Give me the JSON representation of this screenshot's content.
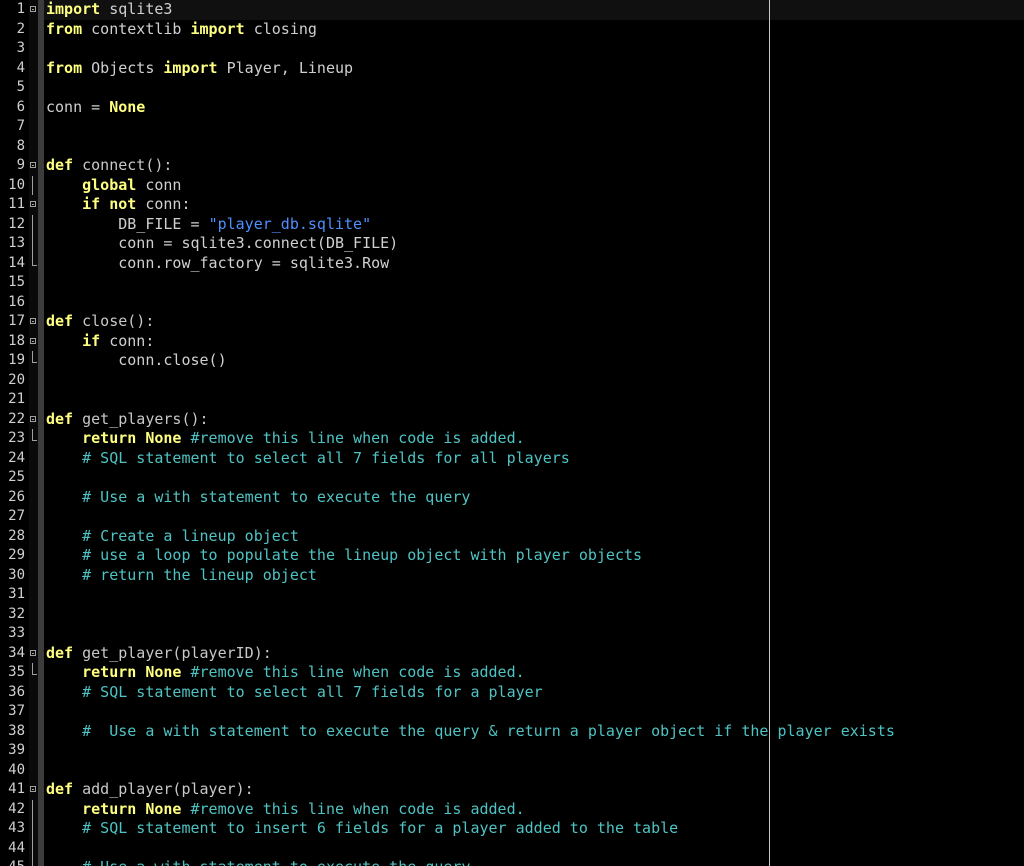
{
  "editor": {
    "lines": [
      {
        "n": "1",
        "fold": "box",
        "tokens": [
          {
            "t": "kw",
            "v": "import"
          },
          {
            "t": "txt",
            "v": " sqlite3"
          }
        ]
      },
      {
        "n": "2",
        "fold": "",
        "tokens": [
          {
            "t": "kw",
            "v": "from"
          },
          {
            "t": "txt",
            "v": " contextlib "
          },
          {
            "t": "kw",
            "v": "import"
          },
          {
            "t": "txt",
            "v": " closing"
          }
        ]
      },
      {
        "n": "3",
        "fold": "",
        "tokens": []
      },
      {
        "n": "4",
        "fold": "",
        "tokens": [
          {
            "t": "kw",
            "v": "from"
          },
          {
            "t": "txt",
            "v": " Objects "
          },
          {
            "t": "kw",
            "v": "import"
          },
          {
            "t": "txt",
            "v": " Player, Lineup"
          }
        ]
      },
      {
        "n": "5",
        "fold": "",
        "tokens": []
      },
      {
        "n": "6",
        "fold": "",
        "tokens": [
          {
            "t": "txt",
            "v": "conn = "
          },
          {
            "t": "kw",
            "v": "None"
          }
        ]
      },
      {
        "n": "7",
        "fold": "",
        "tokens": []
      },
      {
        "n": "8",
        "fold": "",
        "tokens": []
      },
      {
        "n": "9",
        "fold": "box",
        "tokens": [
          {
            "t": "kw",
            "v": "def"
          },
          {
            "t": "fn",
            "v": " connect():"
          }
        ]
      },
      {
        "n": "10",
        "fold": "line",
        "tokens": [
          {
            "t": "txt",
            "v": "    "
          },
          {
            "t": "kw",
            "v": "global"
          },
          {
            "t": "txt",
            "v": " conn"
          }
        ]
      },
      {
        "n": "11",
        "fold": "box",
        "tokens": [
          {
            "t": "txt",
            "v": "    "
          },
          {
            "t": "kw",
            "v": "if not"
          },
          {
            "t": "txt",
            "v": " conn:"
          }
        ]
      },
      {
        "n": "12",
        "fold": "line",
        "tokens": [
          {
            "t": "txt",
            "v": "        DB_FILE = "
          },
          {
            "t": "str",
            "v": "\"player_db.sqlite\""
          }
        ]
      },
      {
        "n": "13",
        "fold": "line",
        "tokens": [
          {
            "t": "txt",
            "v": "        conn = sqlite3.connect(DB_FILE)"
          }
        ]
      },
      {
        "n": "14",
        "fold": "end",
        "tokens": [
          {
            "t": "txt",
            "v": "        conn.row_factory = sqlite3.Row"
          }
        ]
      },
      {
        "n": "15",
        "fold": "",
        "tokens": []
      },
      {
        "n": "16",
        "fold": "",
        "tokens": []
      },
      {
        "n": "17",
        "fold": "box",
        "tokens": [
          {
            "t": "kw",
            "v": "def"
          },
          {
            "t": "fn",
            "v": " close():"
          }
        ]
      },
      {
        "n": "18",
        "fold": "box",
        "tokens": [
          {
            "t": "txt",
            "v": "    "
          },
          {
            "t": "kw",
            "v": "if"
          },
          {
            "t": "txt",
            "v": " conn:"
          }
        ]
      },
      {
        "n": "19",
        "fold": "end",
        "tokens": [
          {
            "t": "txt",
            "v": "        conn.close()"
          }
        ]
      },
      {
        "n": "20",
        "fold": "",
        "tokens": []
      },
      {
        "n": "21",
        "fold": "",
        "tokens": []
      },
      {
        "n": "22",
        "fold": "box",
        "tokens": [
          {
            "t": "kw",
            "v": "def"
          },
          {
            "t": "fn",
            "v": " get_players():"
          }
        ]
      },
      {
        "n": "23",
        "fold": "end",
        "tokens": [
          {
            "t": "txt",
            "v": "    "
          },
          {
            "t": "kw",
            "v": "return None"
          },
          {
            "t": "txt",
            "v": " "
          },
          {
            "t": "com",
            "v": "#remove this line when code is added."
          }
        ]
      },
      {
        "n": "24",
        "fold": "",
        "tokens": [
          {
            "t": "txt",
            "v": "    "
          },
          {
            "t": "com",
            "v": "# SQL statement to select all 7 fields for all players"
          }
        ]
      },
      {
        "n": "25",
        "fold": "",
        "tokens": []
      },
      {
        "n": "26",
        "fold": "",
        "tokens": [
          {
            "t": "txt",
            "v": "    "
          },
          {
            "t": "com",
            "v": "# Use a with statement to execute the query"
          }
        ]
      },
      {
        "n": "27",
        "fold": "",
        "tokens": []
      },
      {
        "n": "28",
        "fold": "",
        "tokens": [
          {
            "t": "txt",
            "v": "    "
          },
          {
            "t": "com",
            "v": "# Create a lineup object"
          }
        ]
      },
      {
        "n": "29",
        "fold": "",
        "tokens": [
          {
            "t": "txt",
            "v": "    "
          },
          {
            "t": "com",
            "v": "# use a loop to populate the lineup object with player objects"
          }
        ]
      },
      {
        "n": "30",
        "fold": "",
        "tokens": [
          {
            "t": "txt",
            "v": "    "
          },
          {
            "t": "com",
            "v": "# return the lineup object"
          }
        ]
      },
      {
        "n": "31",
        "fold": "",
        "tokens": []
      },
      {
        "n": "32",
        "fold": "",
        "tokens": []
      },
      {
        "n": "33",
        "fold": "",
        "tokens": []
      },
      {
        "n": "34",
        "fold": "box",
        "tokens": [
          {
            "t": "kw",
            "v": "def"
          },
          {
            "t": "fn",
            "v": " get_player(playerID):"
          }
        ]
      },
      {
        "n": "35",
        "fold": "end",
        "tokens": [
          {
            "t": "txt",
            "v": "    "
          },
          {
            "t": "kw",
            "v": "return None"
          },
          {
            "t": "txt",
            "v": " "
          },
          {
            "t": "com",
            "v": "#remove this line when code is added."
          }
        ]
      },
      {
        "n": "36",
        "fold": "",
        "tokens": [
          {
            "t": "txt",
            "v": "    "
          },
          {
            "t": "com",
            "v": "# SQL statement to select all 7 fields for a player"
          }
        ]
      },
      {
        "n": "37",
        "fold": "",
        "tokens": []
      },
      {
        "n": "38",
        "fold": "",
        "tokens": [
          {
            "t": "txt",
            "v": "    "
          },
          {
            "t": "com",
            "v": "#  Use a with statement to execute the query & return a player object if the player exists"
          }
        ]
      },
      {
        "n": "39",
        "fold": "",
        "tokens": []
      },
      {
        "n": "40",
        "fold": "",
        "tokens": []
      },
      {
        "n": "41",
        "fold": "box",
        "tokens": [
          {
            "t": "kw",
            "v": "def"
          },
          {
            "t": "fn",
            "v": " add_player(player):"
          }
        ]
      },
      {
        "n": "42",
        "fold": "line",
        "tokens": [
          {
            "t": "txt",
            "v": "    "
          },
          {
            "t": "kw",
            "v": "return None"
          },
          {
            "t": "txt",
            "v": " "
          },
          {
            "t": "com",
            "v": "#remove this line when code is added."
          }
        ]
      },
      {
        "n": "43",
        "fold": "line",
        "tokens": [
          {
            "t": "txt",
            "v": "    "
          },
          {
            "t": "com",
            "v": "# SQL statement to insert 6 fields for a player added to the table"
          }
        ]
      },
      {
        "n": "44",
        "fold": "line",
        "tokens": []
      },
      {
        "n": "45",
        "fold": "line",
        "tokens": [
          {
            "t": "txt",
            "v": "    "
          },
          {
            "t": "com",
            "v": "# Use a with statement to execute the query"
          }
        ]
      }
    ]
  }
}
